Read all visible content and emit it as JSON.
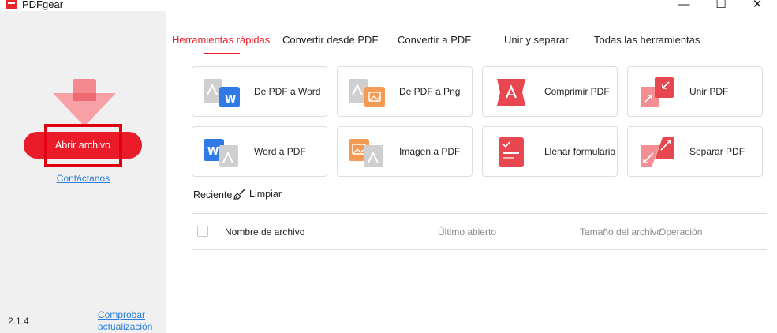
{
  "app": {
    "title": "PDFgear"
  },
  "window": {
    "minimize": "—",
    "maximize": "☐",
    "close": "✕"
  },
  "sidebar": {
    "open_button": "Abrir archivo",
    "contact": "Contáctanos",
    "version": "2.1.4",
    "update_link": "Comprobar actualización"
  },
  "tabs": [
    {
      "label": "Herramientas rápidas",
      "active": true
    },
    {
      "label": "Convertir desde PDF",
      "active": false
    },
    {
      "label": "Convertir a PDF",
      "active": false
    },
    {
      "label": "Unir y separar",
      "active": false
    },
    {
      "label": "Todas las herramientas",
      "active": false
    }
  ],
  "tools": [
    {
      "label": "De PDF a Word",
      "icon": "pdf-to-word-icon"
    },
    {
      "label": "De PDF a Png",
      "icon": "pdf-to-png-icon"
    },
    {
      "label": "Comprimir PDF",
      "icon": "compress-pdf-icon"
    },
    {
      "label": "Unir PDF",
      "icon": "merge-pdf-icon"
    },
    {
      "label": "Word a PDF",
      "icon": "word-to-pdf-icon"
    },
    {
      "label": "Imagen a PDF",
      "icon": "image-to-pdf-icon"
    },
    {
      "label": "Llenar formulario",
      "icon": "fill-form-icon"
    },
    {
      "label": "Separar PDF",
      "icon": "split-pdf-icon"
    }
  ],
  "recent": {
    "title": "Reciente",
    "clean": "Limpiar",
    "columns": {
      "name": "Nombre de archivo",
      "last_opened": "Último abierto",
      "size": "Tamaño del archivc",
      "operation": "Operación"
    }
  },
  "colors": {
    "accent": "#ea1c2a",
    "word_blue": "#2f7ae5",
    "image_orange": "#f59a55",
    "pdf_gray": "#c8c8c8",
    "link": "#2b7de0"
  }
}
